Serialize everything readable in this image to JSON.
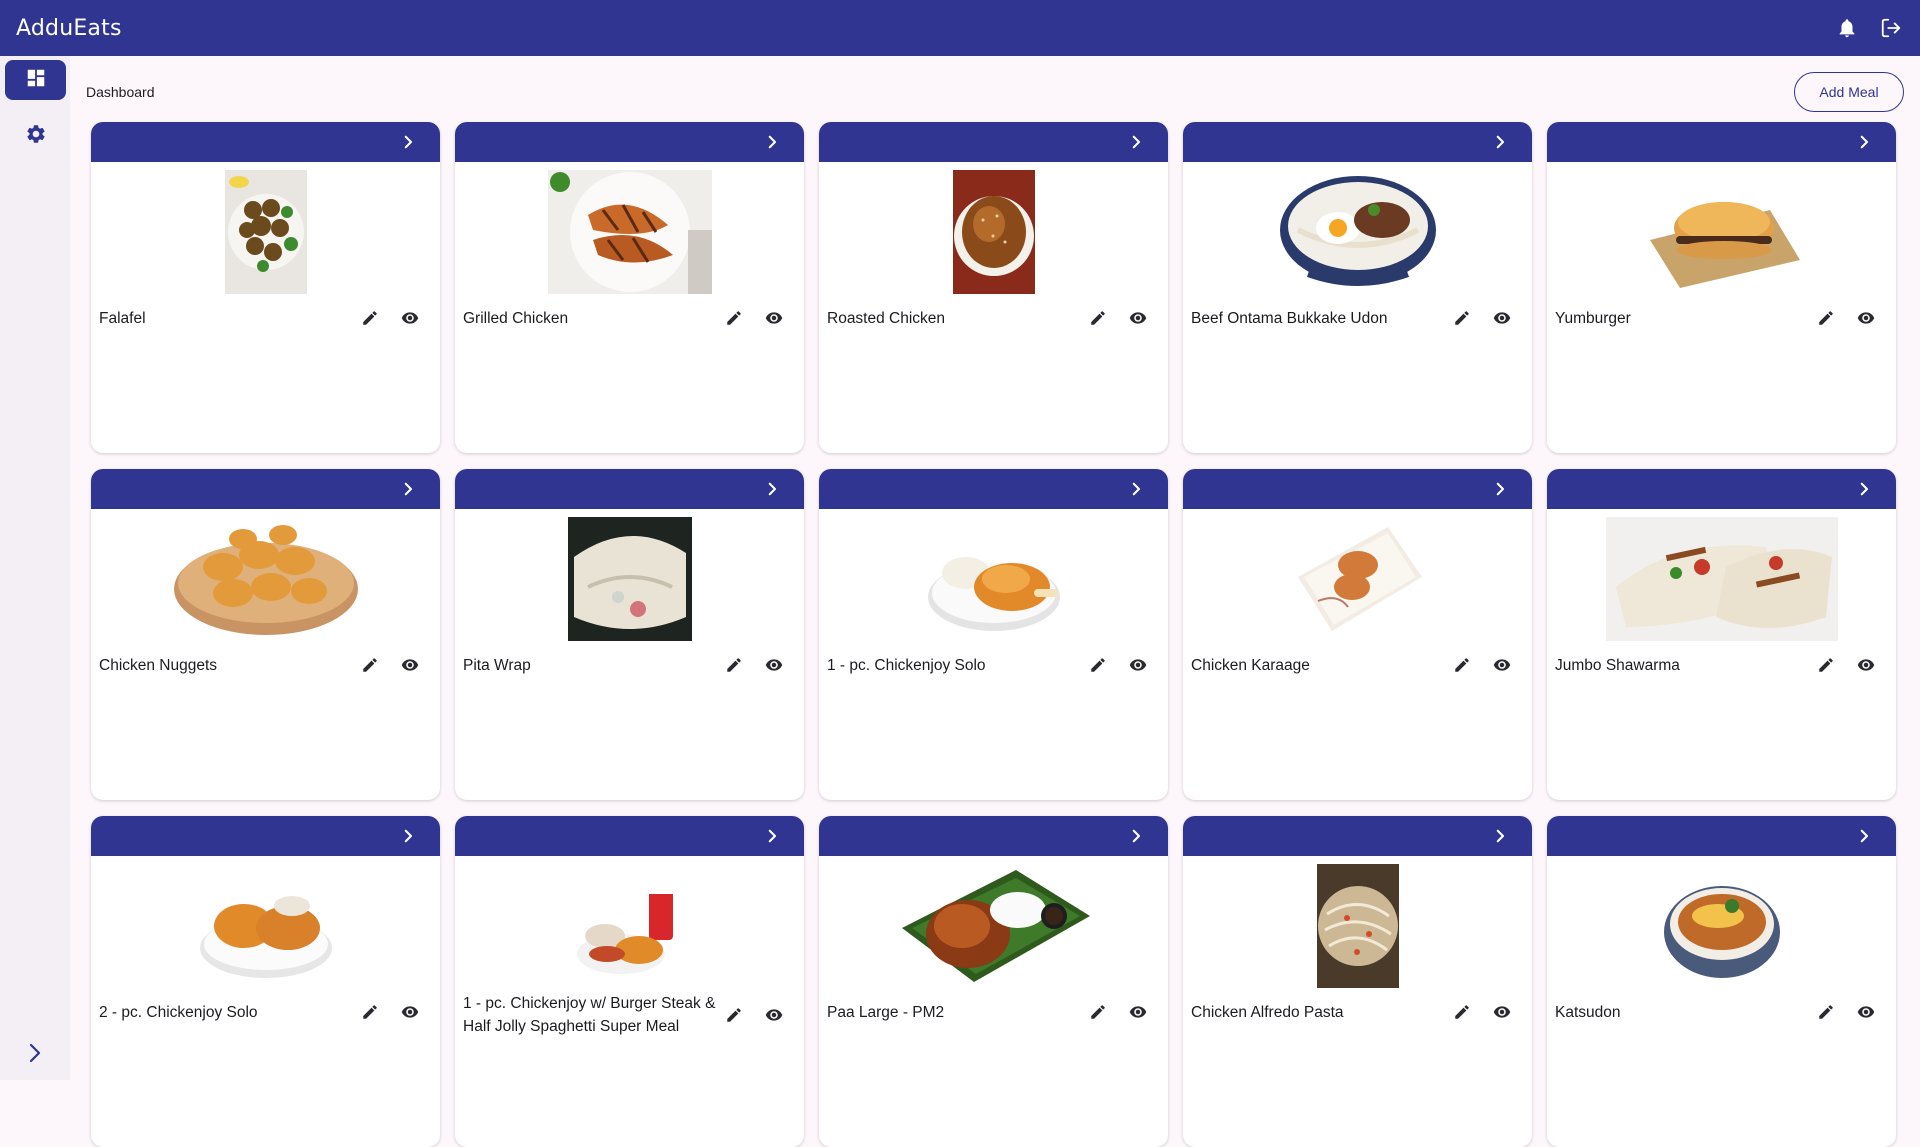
{
  "app": {
    "title": "AdduEats"
  },
  "colors": {
    "primary": "#2f3590",
    "background": "#fdf7fc",
    "sidebar": "#f4eff4"
  },
  "topbar": {
    "icons": [
      "bell-icon",
      "logout-icon"
    ]
  },
  "sidebar": {
    "items": [
      {
        "icon": "dashboard-icon",
        "active": true
      },
      {
        "icon": "gear-icon",
        "active": false
      }
    ],
    "expand_icon": "chevron-right-icon"
  },
  "main": {
    "title": "Dashboard",
    "add_button": "Add Meal"
  },
  "meals": [
    {
      "name": "Falafel",
      "image": "falafel"
    },
    {
      "name": "Grilled Chicken",
      "image": "grilled-chicken"
    },
    {
      "name": "Roasted Chicken",
      "image": "roasted-chicken"
    },
    {
      "name": "Beef Ontama Bukkake Udon",
      "image": "udon-bowl"
    },
    {
      "name": "Yumburger",
      "image": "burger"
    },
    {
      "name": "Chicken Nuggets",
      "image": "nuggets"
    },
    {
      "name": "Pita Wrap",
      "image": "pita-wrap"
    },
    {
      "name": "1 - pc. Chickenjoy Solo",
      "image": "chickenjoy-1pc"
    },
    {
      "name": "Chicken Karaage",
      "image": "karaage"
    },
    {
      "name": "Jumbo Shawarma",
      "image": "shawarma"
    },
    {
      "name": "2 - pc. Chickenjoy Solo",
      "image": "chickenjoy-2pc"
    },
    {
      "name": "1 - pc. Chickenjoy w/ Burger Steak & Half Jolly Spaghetti Super Meal",
      "image": "super-meal"
    },
    {
      "name": "Paa Large - PM2",
      "image": "paa-large"
    },
    {
      "name": "Chicken Alfredo Pasta",
      "image": "alfredo"
    },
    {
      "name": "Katsudon",
      "image": "katsudon"
    }
  ]
}
